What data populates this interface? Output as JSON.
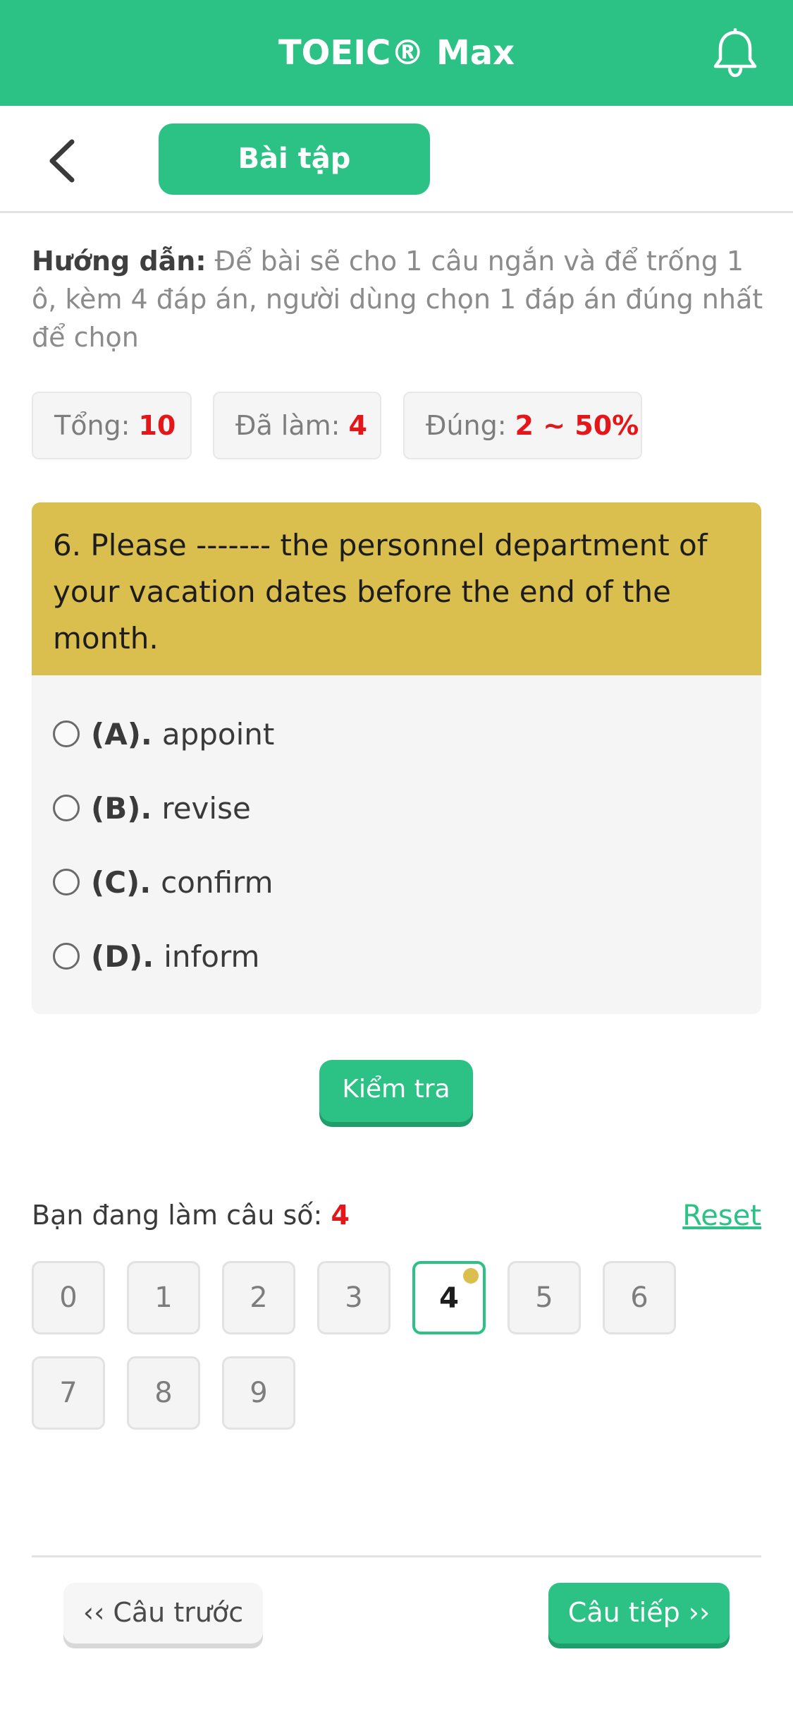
{
  "header": {
    "title": "TOEIC® Max",
    "icon": "bell-icon"
  },
  "subheader": {
    "back_icon": "chevron-left-icon",
    "tab_label": "Bài tập"
  },
  "instruction": {
    "label": "Hướng dẫn:",
    "text": "Để bài sẽ cho 1 câu ngắn và để trống 1 ô, kèm 4 đáp án, người dùng chọn 1 đáp án đúng nhất để chọn"
  },
  "stats": {
    "total_label": "Tổng:",
    "total_value": "10",
    "done_label": "Đã làm:",
    "done_value": "4",
    "correct_label": "Đúng:",
    "correct_value": "2 ~ 50%"
  },
  "question": {
    "text": "6. Please ------- the personnel department of your vacation dates before the end of the month.",
    "options": [
      {
        "key": "(A).",
        "text": "appoint"
      },
      {
        "key": "(B).",
        "text": "revise"
      },
      {
        "key": "(C).",
        "text": "confirm"
      },
      {
        "key": "(D).",
        "text": "inform"
      }
    ]
  },
  "check_button": "Kiểm tra",
  "progress": {
    "label": "Bạn đang làm câu số:",
    "current": "4",
    "reset": "Reset",
    "numbers": [
      "0",
      "1",
      "2",
      "3",
      "4",
      "5",
      "6",
      "7",
      "8",
      "9"
    ],
    "active_index": 4
  },
  "nav": {
    "prev": "‹‹ Câu trước",
    "next": "Câu tiếp ››"
  },
  "colors": {
    "primary": "#2cc286",
    "question_bg": "#dabf4f",
    "highlight": "#e5161a"
  }
}
